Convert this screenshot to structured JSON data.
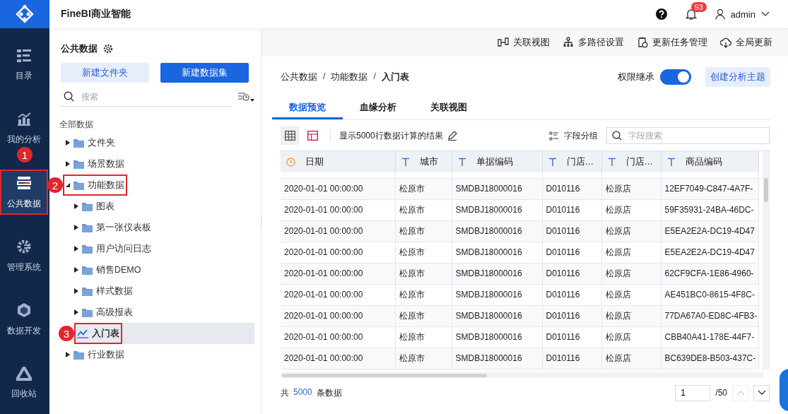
{
  "header": {
    "logo_title": "FineBI商业智能",
    "notification_count": "93",
    "user": "admin"
  },
  "nav": {
    "items": [
      {
        "label": "目录",
        "selected": false,
        "highlighted": false
      },
      {
        "label": "我的分析",
        "selected": false,
        "highlighted": false
      },
      {
        "label": "公共数据",
        "selected": true,
        "highlighted": true,
        "callout": "1"
      },
      {
        "label": "管理系统",
        "selected": false,
        "highlighted": false
      },
      {
        "label": "数据开发",
        "selected": false,
        "highlighted": false
      },
      {
        "label": "回收站",
        "selected": false,
        "highlighted": false
      }
    ]
  },
  "tree_panel": {
    "title": "公共数据",
    "new_folder_button": "新建文件夹",
    "new_dataset_button": "新建数据集",
    "search": {
      "placeholder": "搜索"
    },
    "root_label": "全部数据",
    "items": [
      {
        "label": "文件夹",
        "kind": "folder",
        "expanded": false,
        "selected": false,
        "highlighted": false
      },
      {
        "label": "场景数据",
        "kind": "folder",
        "expanded": false,
        "selected": false,
        "highlighted": false
      },
      {
        "label": "功能数据",
        "kind": "folder",
        "expanded": true,
        "selected": false,
        "highlighted": true,
        "callout": "2",
        "children": [
          {
            "label": "图表",
            "kind": "folder",
            "expanded": false,
            "selected": false,
            "highlighted": false
          },
          {
            "label": "第一张仪表板",
            "kind": "folder",
            "expanded": false,
            "selected": false,
            "highlighted": false
          },
          {
            "label": "用户访问日志",
            "kind": "folder",
            "expanded": false,
            "selected": false,
            "highlighted": false
          },
          {
            "label": "销售DEMO",
            "kind": "folder",
            "expanded": false,
            "selected": false,
            "highlighted": false
          },
          {
            "label": "样式数据",
            "kind": "folder",
            "expanded": false,
            "selected": false,
            "highlighted": false
          },
          {
            "label": "高级报表",
            "kind": "folder",
            "expanded": false,
            "selected": false,
            "highlighted": false
          },
          {
            "label": "入门表",
            "kind": "table",
            "selected": true,
            "highlighted": true,
            "callout": "3"
          }
        ]
      },
      {
        "label": "行业数据",
        "kind": "folder",
        "expanded": false,
        "selected": false,
        "highlighted": false
      }
    ]
  },
  "toolbar": [
    {
      "label": "关联视图"
    },
    {
      "label": "多路径设置"
    },
    {
      "label": "更新任务管理"
    },
    {
      "label": "全局更新"
    }
  ],
  "breadcrumb": [
    {
      "kind": "item",
      "label": "公共数据"
    },
    {
      "kind": "separator",
      "label": "/"
    },
    {
      "kind": "item",
      "label": "功能数据"
    },
    {
      "kind": "separator",
      "label": "/"
    },
    {
      "kind": "current",
      "label": "入门表"
    }
  ],
  "inherit_toggle": {
    "label": "权限继承",
    "on": true
  },
  "create_topic_button": "创建分析主题",
  "tabs": [
    {
      "label": "数据预览",
      "selected": true
    },
    {
      "label": "血缘分析",
      "selected": false
    },
    {
      "label": "关联视图",
      "selected": false
    }
  ],
  "view_buttons": [
    {
      "kind": "grid",
      "selected": true
    },
    {
      "kind": "layout",
      "selected": false
    }
  ],
  "row_limit_text": "显示5000行数据计算的结果",
  "field_group_button": "字段分组",
  "field_search": {
    "placeholder": "字段搜索"
  },
  "table": {
    "columns": [
      {
        "label": "日期",
        "kind": "date"
      },
      {
        "label": "城市",
        "kind": "text"
      },
      {
        "label": "单据编码",
        "kind": "text"
      },
      {
        "label": "门店…",
        "kind": "text"
      },
      {
        "label": "门店…",
        "kind": "text"
      },
      {
        "label": "商品编码",
        "kind": "text"
      }
    ],
    "rows": [
      [
        "2020-01-01 00:00:00",
        "松原市",
        "SMDBJ18000016",
        "D010116",
        "松原店",
        "12EF7049-C847-4A7F-"
      ],
      [
        "2020-01-01 00:00:00",
        "松原市",
        "SMDBJ18000016",
        "D010116",
        "松原店",
        "59F35931-24BA-46DC-"
      ],
      [
        "2020-01-01 00:00:00",
        "松原市",
        "SMDBJ18000016",
        "D010116",
        "松原店",
        "E5EA2E2A-DC19-4D47"
      ],
      [
        "2020-01-01 00:00:00",
        "松原市",
        "SMDBJ18000016",
        "D010116",
        "松原店",
        "E5EA2E2A-DC19-4D47"
      ],
      [
        "2020-01-01 00:00:00",
        "松原市",
        "SMDBJ18000016",
        "D010116",
        "松原店",
        "62CF9CFA-1E86-4960-"
      ],
      [
        "2020-01-01 00:00:00",
        "松原市",
        "SMDBJ18000016",
        "D010116",
        "松原店",
        "AE451BC0-8615-4F8C-"
      ],
      [
        "2020-01-01 00:00:00",
        "松原市",
        "SMDBJ18000016",
        "D010116",
        "松原店",
        "77DA67A0-ED8C-4FB3-"
      ],
      [
        "2020-01-01 00:00:00",
        "松原市",
        "SMDBJ18000016",
        "D010116",
        "松原店",
        "CBB40A41-178E-44F7-"
      ],
      [
        "2020-01-01 00:00:00",
        "松原市",
        "SMDBJ18000016",
        "D010116",
        "松原店",
        "BC639DE8-B503-437C-"
      ]
    ]
  },
  "footer": {
    "prefix": "共",
    "count": "5000",
    "suffix": "条数据"
  },
  "pagination": {
    "page": "1",
    "total": "/50",
    "buttons": [
      {
        "kind": "up",
        "disabled": true
      },
      {
        "kind": "down",
        "disabled": false
      }
    ]
  }
}
